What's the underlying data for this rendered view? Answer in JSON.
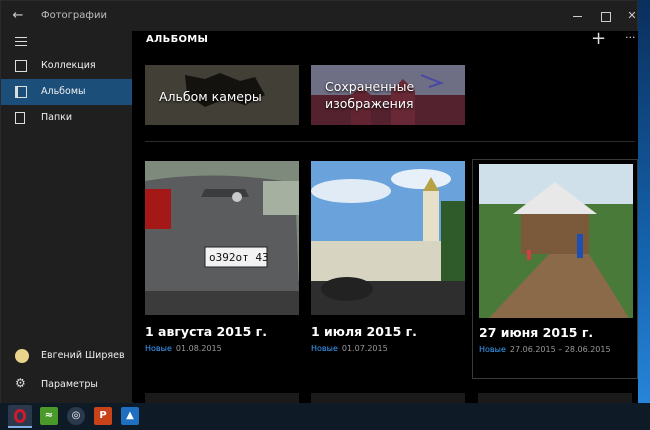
{
  "window": {
    "title": "Фотографии",
    "close_glyph": "✕"
  },
  "sidebar": {
    "items": [
      {
        "label": "Коллекция",
        "icon": "collection-icon"
      },
      {
        "label": "Альбомы",
        "icon": "albums-icon",
        "active": true
      },
      {
        "label": "Папки",
        "icon": "folder-icon"
      }
    ],
    "user_name": "Евгений Ширяев",
    "settings_label": "Параметры"
  },
  "main": {
    "title": "АЛЬБОМЫ",
    "add_glyph": "+",
    "more_glyph": "···",
    "special_albums": [
      {
        "label": "Альбом камеры"
      },
      {
        "label_line1": "Сохраненные",
        "label_line2": "изображения"
      }
    ],
    "albums": [
      {
        "title": "1 августа 2015 г.",
        "badge": "Новые",
        "date": "01.08.2015",
        "plate_text": "о392от 43"
      },
      {
        "title": "1 июля 2015 г.",
        "badge": "Новые",
        "date": "01.07.2015"
      },
      {
        "title": "27 июня 2015 г.",
        "badge": "Новые",
        "date": "27.06.2015 – 28.06.2015"
      }
    ]
  },
  "taskbar": {
    "apps": [
      "opera-icon",
      "rss-icon",
      "network-icon",
      "powerpoint-icon",
      "photos-icon"
    ],
    "powerpoint_letter": "P"
  },
  "colors": {
    "accent": "#1b4e78",
    "badge": "#3ca0ff",
    "sidebar_bg": "#1f1f1f",
    "opera_red": "#c8102e"
  }
}
